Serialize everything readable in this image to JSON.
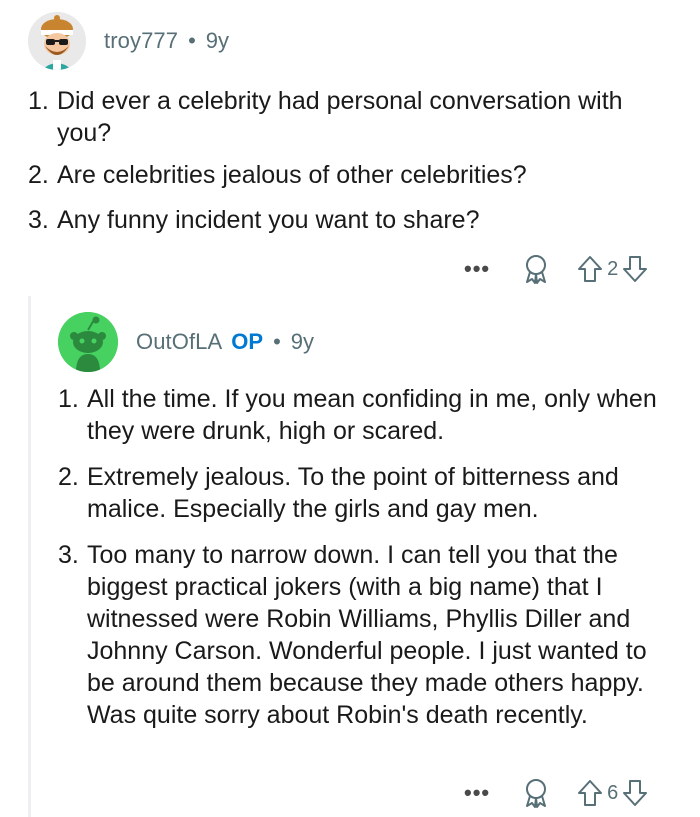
{
  "comments": [
    {
      "username": "troy777",
      "separator": "•",
      "age": "9y",
      "items": [
        {
          "num": "1.",
          "text": "Did ever a celebrity had personal conversation with you?"
        },
        {
          "num": "2.",
          "text": "Are celebrities jealous of other celebrities?"
        },
        {
          "num": "3.",
          "text": "Any funny incident you want to share?"
        }
      ],
      "more_label": "•••",
      "vote_count": "2"
    },
    {
      "username": "OutOfLA",
      "op_badge": "OP",
      "separator": "•",
      "age": "9y",
      "items": [
        {
          "num": "1.",
          "text": "All the time. If you mean confiding in me, only when they were drunk, high or scared."
        },
        {
          "num": "2.",
          "text": "Extremely jealous. To the point of bitterness and malice. Especially the girls and gay men."
        },
        {
          "num": "3.",
          "text": "Too many to narrow down. I can tell you that the biggest practical jokers (with a big name) that I witnessed were Robin Williams, Phyllis Diller and Johnny Carson. Wonderful people. I just wanted to be around them because they made others happy. Was quite sorry about Robin's death recently."
        }
      ],
      "more_label": "•••",
      "vote_count": "6"
    }
  ],
  "icons": {
    "award": "award-icon",
    "upvote": "upvote-arrow-icon",
    "downvote": "downvote-arrow-icon",
    "more": "more-options-icon"
  },
  "colors": {
    "meta_text": "#576f76",
    "op_badge": "#0079d3",
    "body_text": "#1a1a1b",
    "snoo_green": "#46d160"
  }
}
